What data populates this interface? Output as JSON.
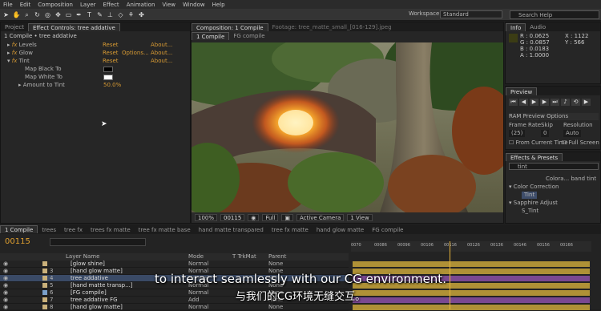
{
  "menu": [
    "File",
    "Edit",
    "Composition",
    "Layer",
    "Effect",
    "Animation",
    "View",
    "Window",
    "Help"
  ],
  "workspace": {
    "label": "Workspace:",
    "value": "Standard"
  },
  "search": {
    "placeholder": "Search Help"
  },
  "left_panel": {
    "tabs": [
      "Project",
      "Effect Controls: tree addative"
    ],
    "breadcrumb": "1 Compile • tree addative",
    "effects": [
      {
        "name": "Levels",
        "reset": "Reset",
        "about": "About..."
      },
      {
        "name": "Glow",
        "reset": "Reset",
        "options": "Options...",
        "about": "About..."
      },
      {
        "name": "Tint",
        "reset": "Reset",
        "about": "About..."
      }
    ],
    "tint_props": [
      {
        "name": "Map Black To"
      },
      {
        "name": "Map White To"
      },
      {
        "name": "Amount to Tint",
        "value": "50.0%"
      }
    ]
  },
  "comp_panel": {
    "tabs": [
      "Composition: 1 Compile",
      "Footage: tree_matte_small_[016-129].jpeg"
    ],
    "subtabs": [
      "1 Compile",
      "FG compile"
    ],
    "zoom": "100%",
    "timecode": "00115",
    "resolution": "Full",
    "camera": "Active Camera",
    "view": "1 View"
  },
  "info_panel": {
    "tabs": [
      "Info",
      "Audio"
    ],
    "R": "R : 0.0625",
    "G": "G : 0.0857",
    "B": "B : 0.0183",
    "A": "A : 1.0000",
    "X": "X : 1122",
    "Y": "Y : 566"
  },
  "preview_panel": {
    "title": "Preview",
    "options": "RAM Preview Options",
    "frame_rate_label": "Frame Rate",
    "skip_label": "Skip",
    "resolution_label": "Resolution",
    "frame_rate": "(25)",
    "skip": "0",
    "resolution": "Auto",
    "from_current": "From Current Time",
    "full_screen": "Full Screen"
  },
  "effects_panel": {
    "title": "Effects & Presets",
    "search": "tint",
    "items": [
      {
        "text": "Colora... band tint"
      },
      {
        "text": "Color Correction"
      },
      {
        "text": "Tint"
      },
      {
        "text": "Sapphire Adjust"
      },
      {
        "text": "S_Tint"
      }
    ]
  },
  "timeline": {
    "tabs": [
      "1 Compile",
      "trees",
      "tree fx",
      "trees fx matte",
      "tree fx matte base",
      "hand matte transpared",
      "tree fx matte",
      "hand glow matte",
      "FG compile"
    ],
    "timecode": "00115",
    "columns": [
      "Layer Name",
      "Mode",
      "T TrkMat",
      "Parent"
    ],
    "ruler": [
      "0070",
      "00086",
      "00096",
      "00106",
      "00116",
      "00126",
      "00136",
      "00146",
      "00156",
      "00166"
    ],
    "layers": [
      {
        "num": "",
        "name": "[glow shine]",
        "mode": "Normal",
        "parent": "None",
        "color": "#c9b07a"
      },
      {
        "num": "3",
        "name": "[hand glow matte]",
        "mode": "Normal",
        "parent": "None",
        "color": "#c9b07a"
      },
      {
        "num": "4",
        "name": "tree addative",
        "mode": "Normal",
        "parent": "None",
        "color": "#c9b07a"
      },
      {
        "num": "5",
        "name": "[hand matte transp...]",
        "mode": "Normal",
        "parent": "None",
        "color": "#c9b07a"
      },
      {
        "num": "6",
        "name": "[FG compile]",
        "mode": "Normal",
        "parent": "None",
        "color": "#7aa0c9"
      },
      {
        "num": "7",
        "name": "tree addative FG",
        "mode": "Add",
        "parent": "None",
        "color": "#c9b07a"
      },
      {
        "num": "8",
        "name": "[hand glow matte]",
        "mode": "Normal",
        "parent": "None",
        "color": "#c9b07a"
      }
    ]
  },
  "subtitles": {
    "en": "to interact seamlessly with our CG environment.",
    "zh": "与我们的CG环境无缝交互。"
  },
  "colors": {
    "accent": "#d79a33",
    "bar_gold": "#c8a43a",
    "bar_purple": "#8a4fa5",
    "playhead": "#e8b43a"
  }
}
